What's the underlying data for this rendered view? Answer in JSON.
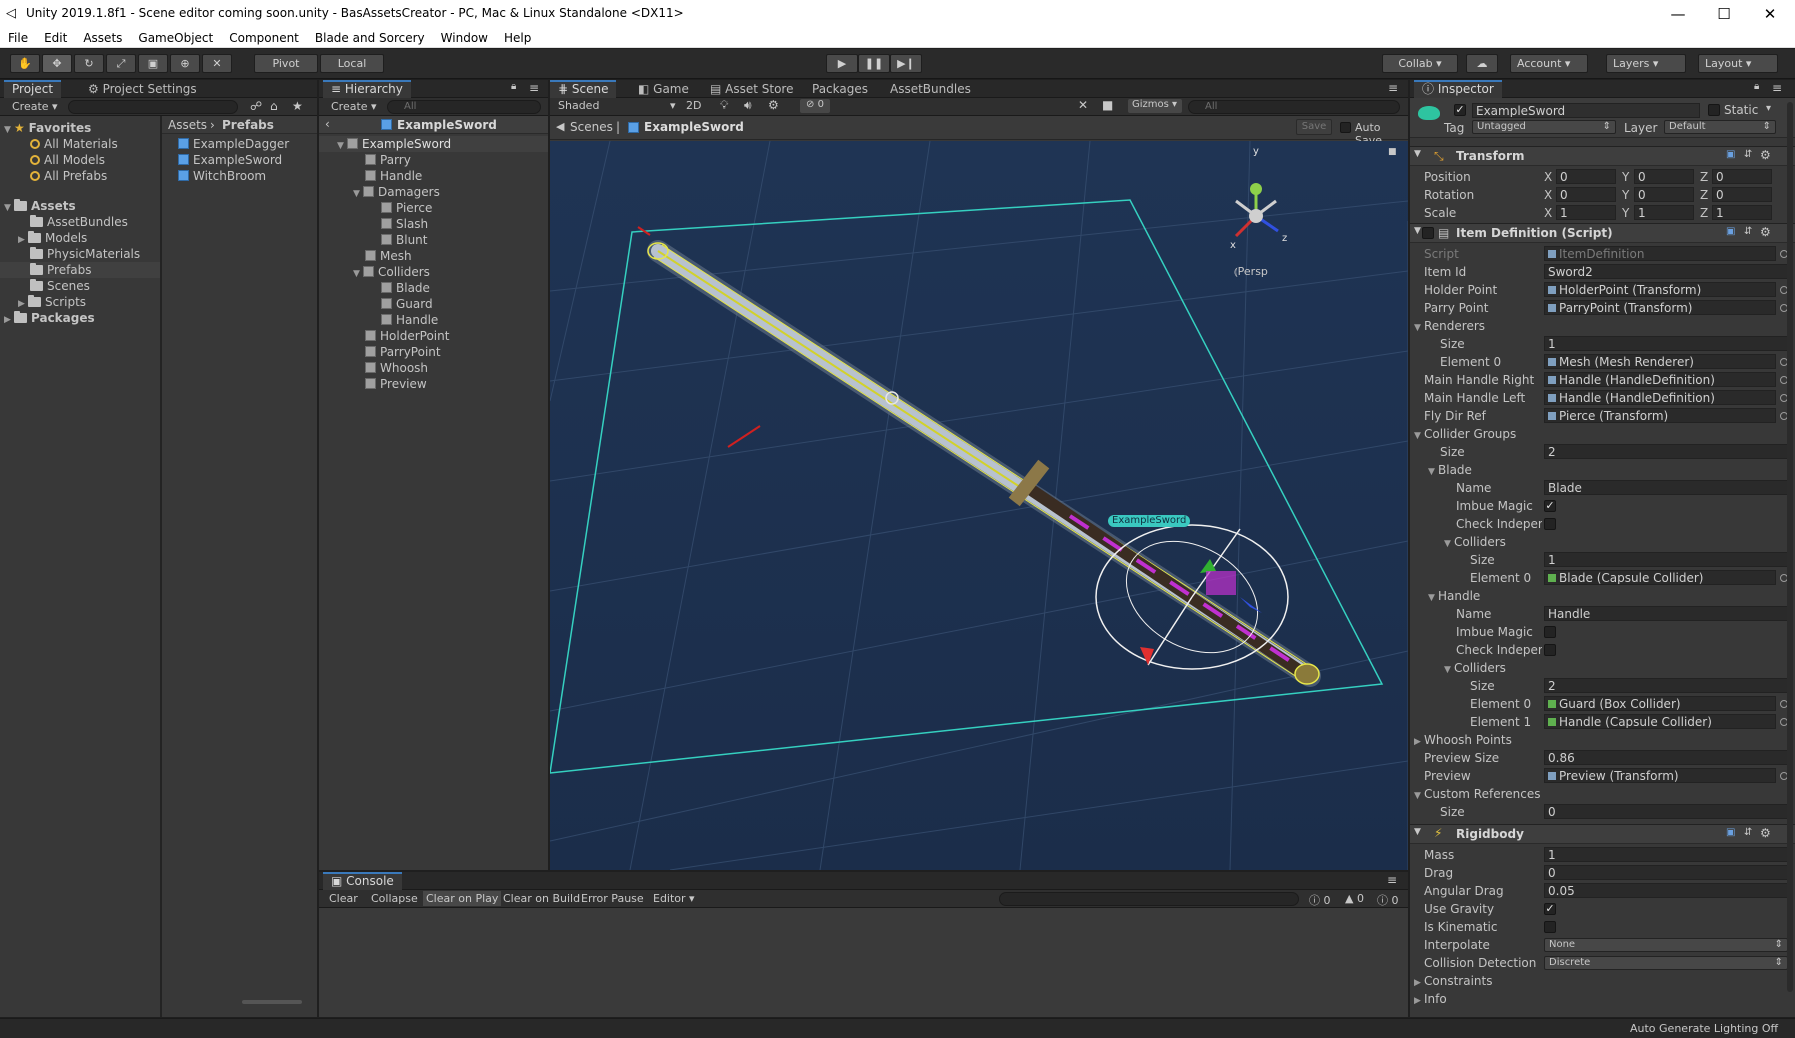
{
  "window": {
    "title": "Unity 2019.1.8f1 - Scene editor coming soon.unity - BasAssetsCreator - PC, Mac & Linux Standalone <DX11>",
    "controls": [
      "—",
      "☐",
      "✕"
    ]
  },
  "menu": [
    "File",
    "Edit",
    "Assets",
    "GameObject",
    "Component",
    "Blade and Sorcery",
    "Window",
    "Help"
  ],
  "toolbar": {
    "pivot": "Pivot",
    "local": "Local",
    "collab": "Collab ▾",
    "account": "Account",
    "layers": "Layers",
    "layout": "Layout"
  },
  "project": {
    "tabs": [
      "Project",
      "Project Settings"
    ],
    "create": "Create ▾",
    "favorites_label": "Favorites",
    "favorites": [
      "All Materials",
      "All Models",
      "All Prefabs"
    ],
    "assets_label": "Assets",
    "assets": [
      "AssetBundles",
      "Models",
      "PhysicMaterials",
      "Prefabs",
      "Scenes",
      "Scripts"
    ],
    "packages_label": "Packages",
    "breadcrumb_root": "Assets",
    "breadcrumb_leaf": "Prefabs",
    "files": [
      "ExampleDagger",
      "ExampleSword",
      "WitchBroom"
    ]
  },
  "hierarchy": {
    "tab": "Hierarchy",
    "create": "Create ▾",
    "search_placeholder": "All",
    "root": "ExampleSword",
    "selected": "ExampleSword",
    "items": [
      "Parry",
      "Handle",
      "Damagers",
      "Pierce",
      "Slash",
      "Blunt",
      "Mesh",
      "Colliders",
      "Blade",
      "Guard",
      "Handle",
      "HolderPoint",
      "ParryPoint",
      "Whoosh",
      "Preview"
    ]
  },
  "scene": {
    "tabs": [
      "Scene",
      "Game",
      "Asset Store",
      "Packages",
      "AssetBundles"
    ],
    "shading": "Shaded",
    "mode_2d": "2D",
    "fx_count": "0",
    "gizmos": "Gizmos",
    "search_placeholder": "All",
    "breadcrumb_root": "Scenes",
    "breadcrumb_leaf": "ExampleSword",
    "save": "Save",
    "auto_save": "Auto Save",
    "persp": "Persp",
    "object_label": "ExampleSword",
    "axis_y": "y",
    "axis_x": "x",
    "axis_z": "z"
  },
  "console": {
    "tab": "Console",
    "buttons": [
      "Clear",
      "Collapse",
      "Clear on Play",
      "Clear on Build",
      "Error Pause",
      "Editor ▾"
    ],
    "counts": [
      "0",
      "0",
      "0"
    ]
  },
  "inspector": {
    "tab": "Inspector",
    "object_name": "ExampleSword",
    "static": "Static",
    "tag_label": "Tag",
    "tag": "Untagged",
    "layer_label": "Layer",
    "layer": "Default",
    "transform": {
      "title": "Transform",
      "position_label": "Position",
      "position": [
        "0",
        "0",
        "0"
      ],
      "rotation_label": "Rotation",
      "rotation": [
        "0",
        "0",
        "0"
      ],
      "scale_label": "Scale",
      "scale": [
        "1",
        "1",
        "1"
      ]
    },
    "item_def": {
      "title": "Item Definition (Script)",
      "script_label": "Script",
      "script": "ItemDefinition",
      "item_id_label": "Item Id",
      "item_id": "Sword2",
      "holder_point_label": "Holder Point",
      "holder_point": "HolderPoint (Transform)",
      "parry_point_label": "Parry Point",
      "parry_point": "ParryPoint (Transform)",
      "renderers_label": "Renderers",
      "size_label": "Size",
      "renderers_size": "1",
      "element0_label": "Element 0",
      "renderers_el0": "Mesh (Mesh Renderer)",
      "main_handle_right_label": "Main Handle Right",
      "main_handle_right": "Handle (HandleDefinition)",
      "main_handle_left_label": "Main Handle Left",
      "main_handle_left": "Handle (HandleDefinition)",
      "fly_dir_ref_label": "Fly Dir Ref",
      "fly_dir_ref": "Pierce (Transform)",
      "collider_groups_label": "Collider Groups",
      "collider_groups_size": "2",
      "blade_label": "Blade",
      "name_label": "Name",
      "blade_name": "Blade",
      "imbue_magic_label": "Imbue Magic",
      "check_indep_label": "Check Independe",
      "colliders_label": "Colliders",
      "blade_colliders_size": "1",
      "blade_el0": "Blade (Capsule Collider)",
      "handle_label": "Handle",
      "handle_name": "Handle",
      "handle_colliders_size": "2",
      "element1_label": "Element 1",
      "handle_el0": "Guard (Box Collider)",
      "handle_el1": "Handle (Capsule Collider)",
      "whoosh_label": "Whoosh Points",
      "preview_size_label": "Preview Size",
      "preview_size": "0.86",
      "preview_label": "Preview",
      "preview": "Preview (Transform)",
      "custom_refs_label": "Custom References",
      "custom_refs_size": "0"
    },
    "rigidbody": {
      "title": "Rigidbody",
      "mass_label": "Mass",
      "mass": "1",
      "drag_label": "Drag",
      "drag": "0",
      "angular_drag_label": "Angular Drag",
      "angular_drag": "0.05",
      "use_gravity_label": "Use Gravity",
      "is_kinematic_label": "Is Kinematic",
      "interpolate_label": "Interpolate",
      "interpolate": "None",
      "collision_label": "Collision Detection",
      "collision": "Discrete",
      "constraints_label": "Constraints",
      "info_label": "Info"
    }
  },
  "status": {
    "text": "Auto Generate Lighting Off"
  }
}
